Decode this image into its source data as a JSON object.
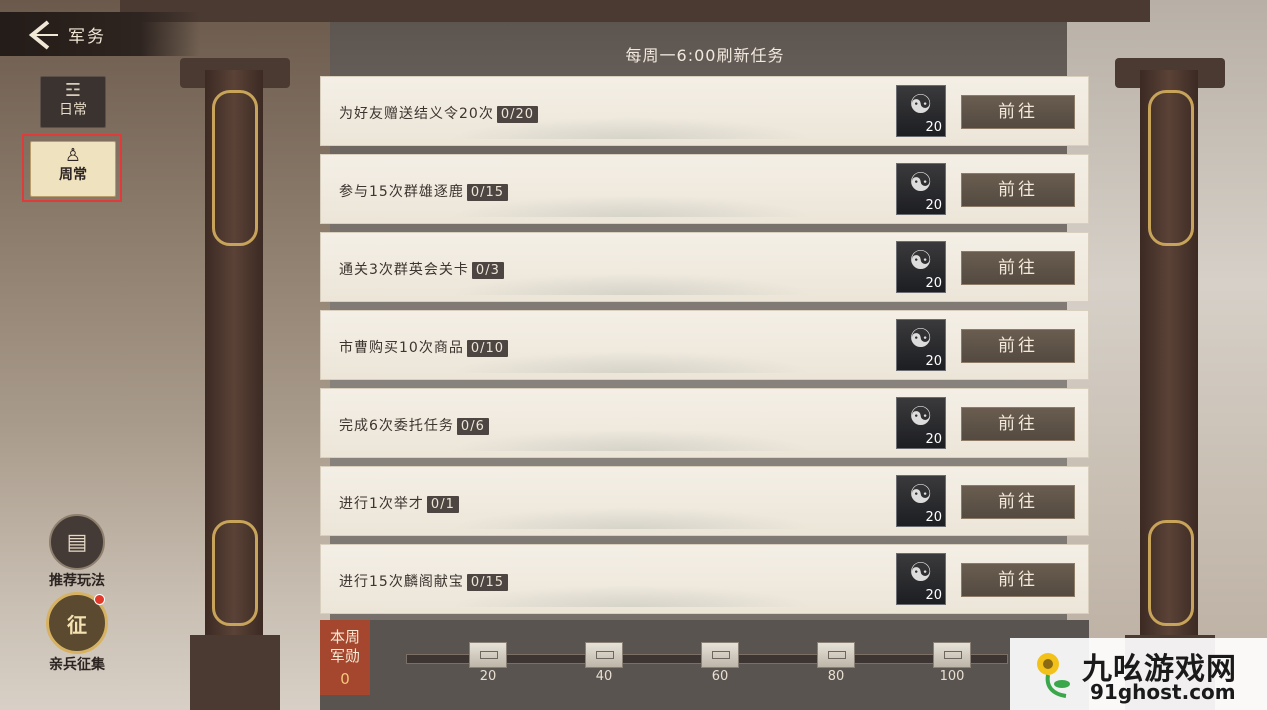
{
  "header": {
    "back_title": "军务",
    "refresh_note": "每周一6:00刷新任务"
  },
  "tabs": [
    {
      "label": "日常",
      "icon": "bag-icon",
      "selected": false
    },
    {
      "label": "周常",
      "icon": "general-portrait-icon",
      "selected": true
    }
  ],
  "side_buttons": {
    "recommend": "推荐玩法",
    "recruit": "亲兵征集",
    "recruit_icon_text": "征"
  },
  "tasks": [
    {
      "name": "为好友赠送结义令20次",
      "progress": "0/20",
      "reward_qty": "20",
      "button": "前往"
    },
    {
      "name": "参与15次群雄逐鹿",
      "progress": "0/15",
      "reward_qty": "20",
      "button": "前往"
    },
    {
      "name": "通关3次群英会关卡",
      "progress": "0/3",
      "reward_qty": "20",
      "button": "前往"
    },
    {
      "name": "市曹购买10次商品",
      "progress": "0/10",
      "reward_qty": "20",
      "button": "前往"
    },
    {
      "name": "完成6次委托任务",
      "progress": "0/6",
      "reward_qty": "20",
      "button": "前往"
    },
    {
      "name": "进行1次举才",
      "progress": "0/1",
      "reward_qty": "20",
      "button": "前往"
    },
    {
      "name": "进行15次麟阁献宝",
      "progress": "0/15",
      "reward_qty": "20",
      "button": "前往"
    }
  ],
  "merit": {
    "label_line1": "本周",
    "label_line2": "军勋",
    "value": "0",
    "milestones": [
      "20",
      "40",
      "60",
      "80",
      "100"
    ]
  },
  "watermark": {
    "name": "九吆游戏网",
    "url": "91ghost.com"
  },
  "colors": {
    "highlight": "#e03b3b",
    "merit_label_bg": "#a5462f"
  }
}
